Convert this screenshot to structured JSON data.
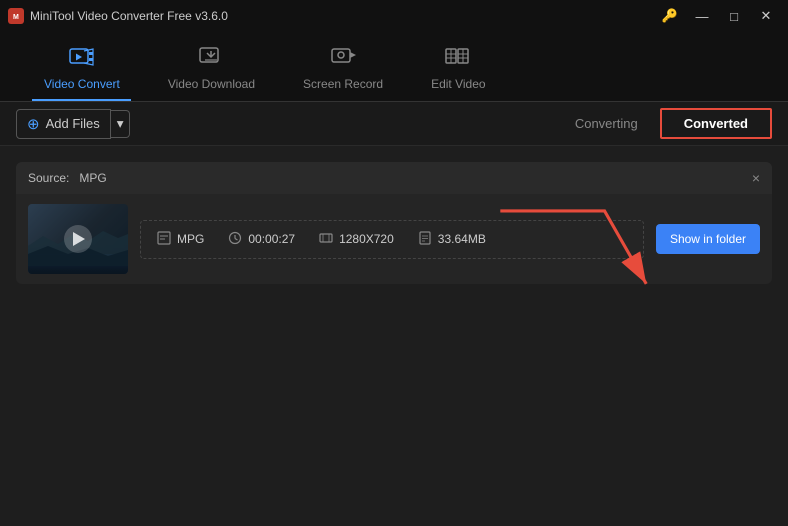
{
  "titleBar": {
    "appName": "MiniTool Video Converter Free v3.6.0",
    "appIconLabel": "M",
    "controls": {
      "key": "🔑",
      "minimize": "—",
      "maximize": "□",
      "close": "✕"
    }
  },
  "topNav": {
    "tabs": [
      {
        "id": "video-convert",
        "label": "Video Convert",
        "active": true
      },
      {
        "id": "video-download",
        "label": "Video Download",
        "active": false
      },
      {
        "id": "screen-record",
        "label": "Screen Record",
        "active": false
      },
      {
        "id": "edit-video",
        "label": "Edit Video",
        "active": false
      }
    ]
  },
  "toolbar": {
    "addFilesLabel": "Add Files",
    "subTabs": [
      {
        "id": "converting",
        "label": "Converting",
        "active": false
      },
      {
        "id": "converted",
        "label": "Converted",
        "active": true
      }
    ]
  },
  "fileCard": {
    "sourceLabel": "Source:",
    "sourceFormat": "MPG",
    "closeLabel": "×",
    "fileInfo": {
      "format": "MPG",
      "duration": "00:00:27",
      "resolution": "1280X720",
      "size": "33.64MB"
    },
    "showFolderBtn": "Show in folder"
  }
}
